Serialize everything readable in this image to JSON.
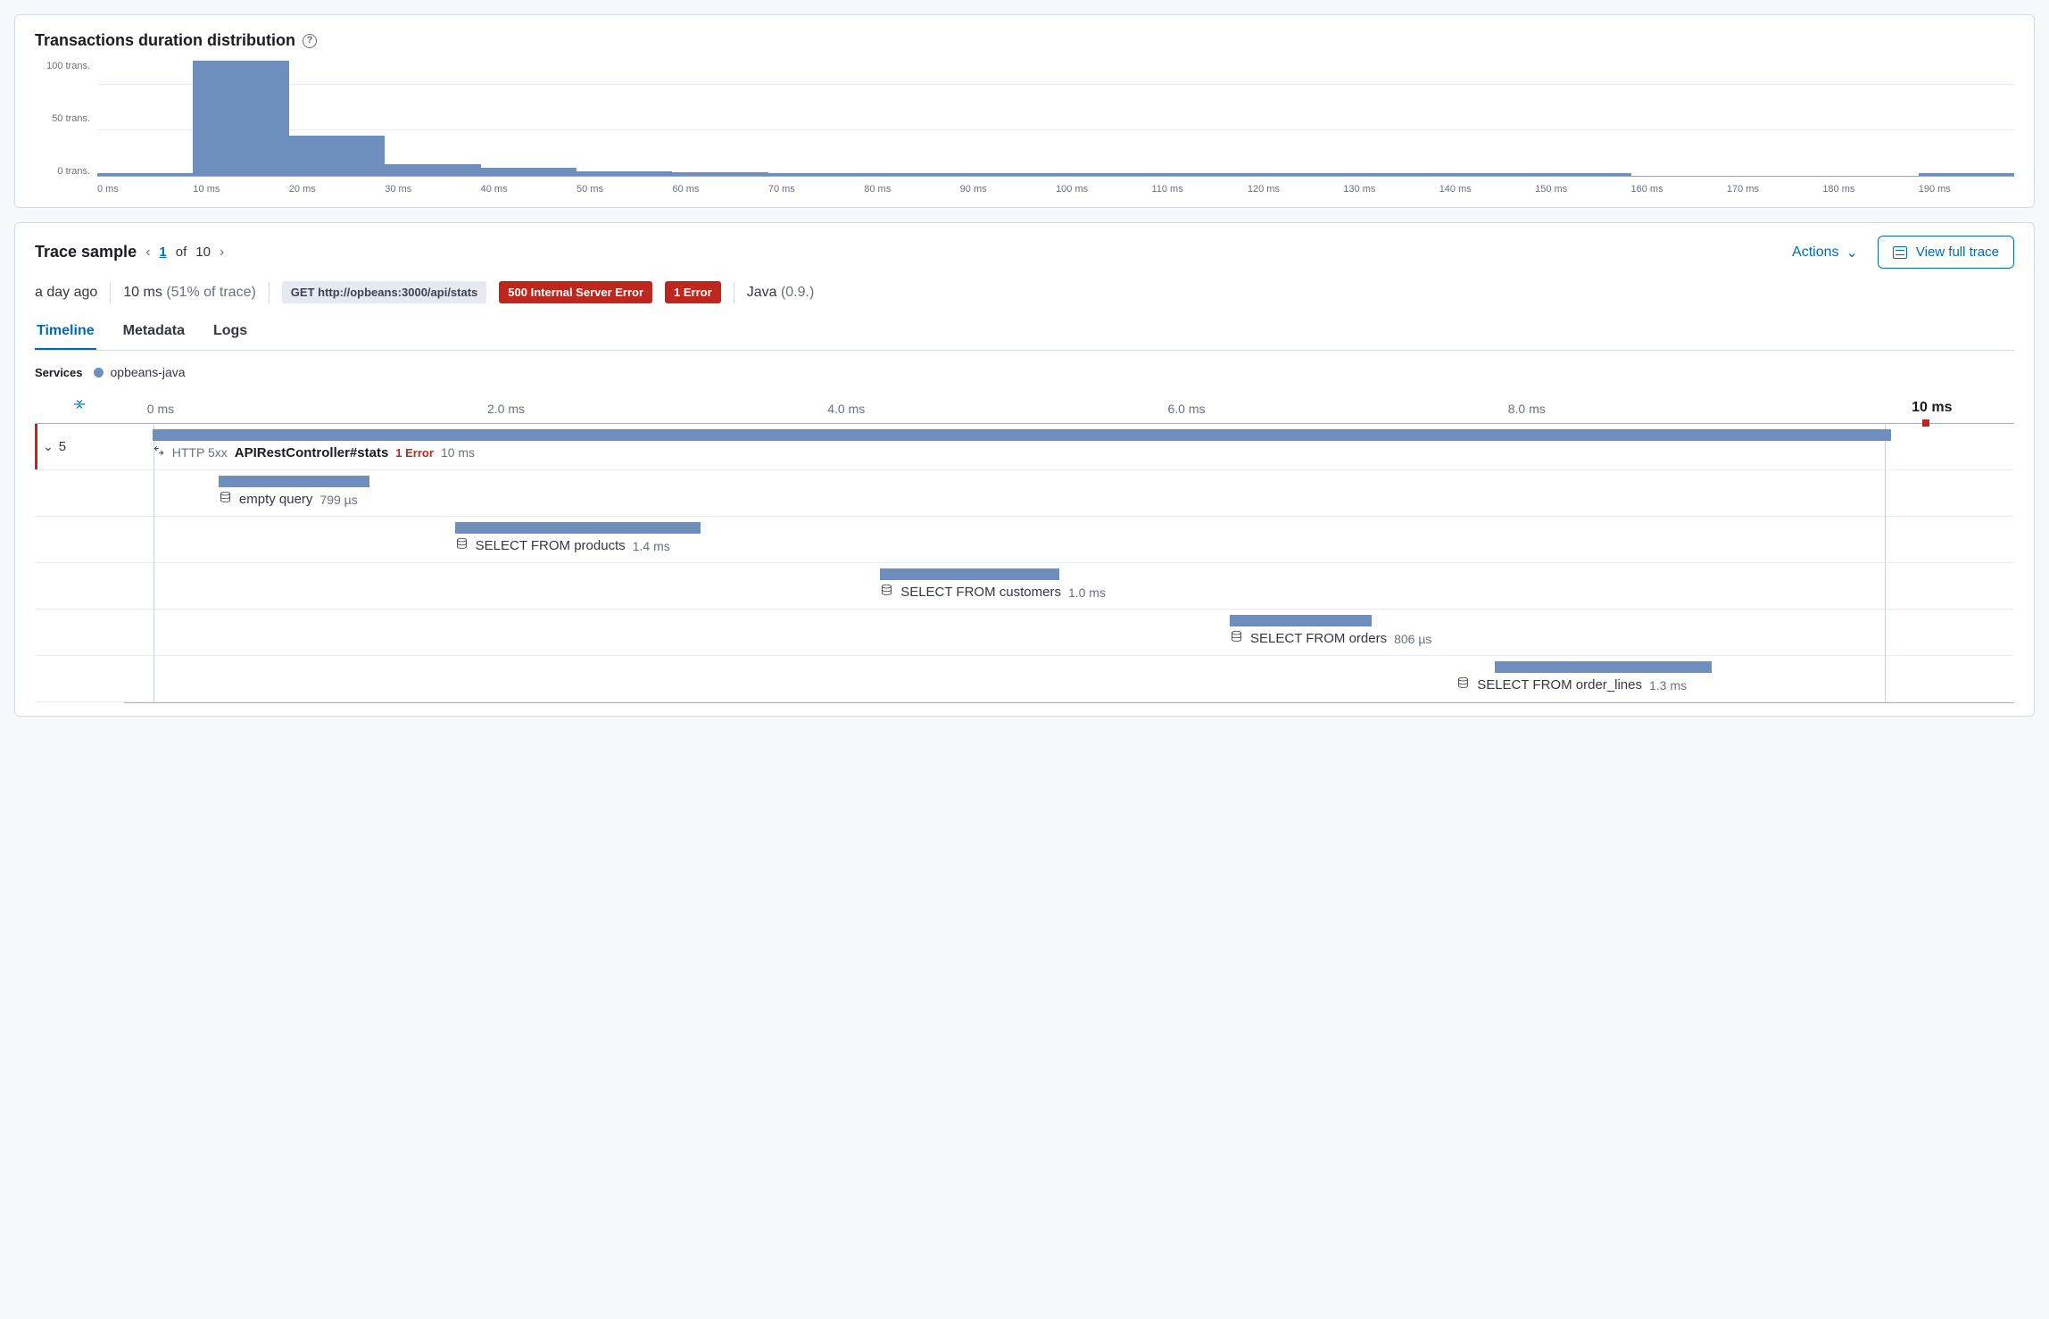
{
  "histogram_panel": {
    "title": "Transactions duration distribution"
  },
  "chart_data": {
    "type": "bar",
    "title": "Transactions duration distribution",
    "xlabel": "",
    "ylabel": "",
    "ylim": [
      0,
      130
    ],
    "y_ticks": [
      "100 trans.",
      "50 trans.",
      "0 trans."
    ],
    "categories": [
      "0 ms",
      "10 ms",
      "20 ms",
      "30 ms",
      "40 ms",
      "50 ms",
      "60 ms",
      "70 ms",
      "80 ms",
      "90 ms",
      "100 ms",
      "110 ms",
      "120 ms",
      "130 ms",
      "140 ms",
      "150 ms",
      "160 ms",
      "170 ms",
      "180 ms",
      "190 ms"
    ],
    "values": [
      3,
      130,
      45,
      13,
      9,
      5,
      4,
      3,
      3,
      3,
      3,
      3,
      3,
      3,
      3,
      3,
      0,
      0,
      0,
      3
    ]
  },
  "trace_sample": {
    "title": "Trace sample",
    "page": {
      "current": "1",
      "of_label": "of",
      "total": "10"
    },
    "actions_label": "Actions",
    "view_full_trace_label": "View full trace",
    "meta": {
      "age": "a day ago",
      "duration": "10 ms",
      "pct": "(51% of trace)",
      "http_badge": "GET http://opbeans:3000/api/stats",
      "status_badge": "500 Internal Server Error",
      "error_badge": "1 Error",
      "lang": "Java",
      "lang_version": "(0.9.)"
    },
    "tabs": {
      "timeline": "Timeline",
      "metadata": "Metadata",
      "logs": "Logs"
    }
  },
  "services": {
    "label": "Services",
    "items": [
      {
        "name": "opbeans-java",
        "color": "#6e8fbd"
      }
    ]
  },
  "timeline": {
    "total_label": "10 ms",
    "total_ms": 10,
    "ticks": [
      "0 ms",
      "2.0 ms",
      "4.0 ms",
      "6.0 ms",
      "8.0 ms"
    ],
    "root": {
      "child_count": "5",
      "http_prefix": "HTTP 5xx",
      "name": "APIRestController#stats",
      "error": "1 Error",
      "duration": "10 ms",
      "bar": {
        "start_pct": 1.5,
        "width_pct": 92.0
      }
    },
    "spans": [
      {
        "name": "empty query",
        "duration": "799 µs",
        "bar": {
          "start_pct": 5.0,
          "width_pct": 8.0
        },
        "label_left_pct": 5.0
      },
      {
        "name": "SELECT FROM products",
        "duration": "1.4 ms",
        "bar": {
          "start_pct": 17.5,
          "width_pct": 13.0
        },
        "label_left_pct": 17.5
      },
      {
        "name": "SELECT FROM customers",
        "duration": "1.0 ms",
        "bar": {
          "start_pct": 40.0,
          "width_pct": 9.5
        },
        "label_left_pct": 40.0
      },
      {
        "name": "SELECT FROM orders",
        "duration": "806 µs",
        "bar": {
          "start_pct": 58.5,
          "width_pct": 7.5
        },
        "label_left_pct": 58.5
      },
      {
        "name": "SELECT FROM order_lines",
        "duration": "1.3 ms",
        "bar": {
          "start_pct": 72.5,
          "width_pct": 11.5
        },
        "label_left_pct": 70.5
      }
    ]
  }
}
